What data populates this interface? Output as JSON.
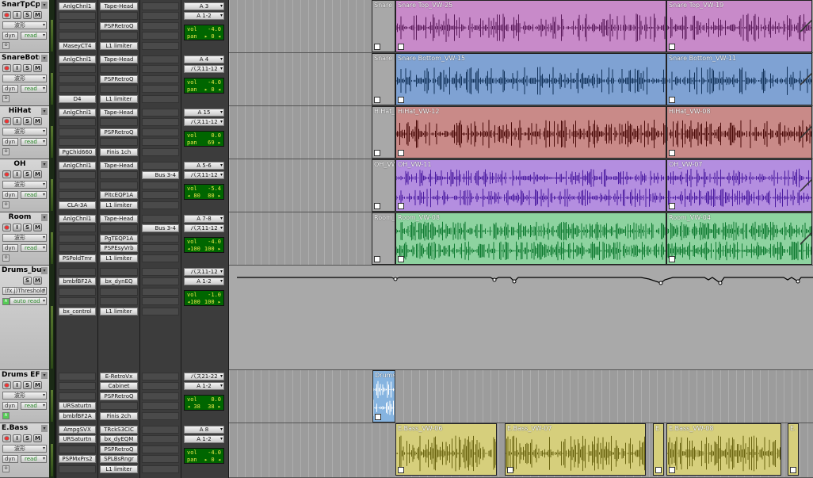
{
  "tracks": [
    {
      "name": "SnarTpCpy",
      "view": "波形",
      "auto": "read",
      "inserts_a": [
        "AnlgChnl1",
        "",
        "",
        "",
        "MaseyCT4"
      ],
      "inserts_b": [
        "Tape-Head",
        "",
        "PSPRetroQ",
        "",
        "L1 limiter"
      ],
      "send": "",
      "out_a": "A 3",
      "out_b": "A 1-2",
      "vol": "-4.0",
      "pan": "▸ 0 ◂"
    },
    {
      "name": "SnareBotm",
      "view": "波形",
      "auto": "read",
      "inserts_a": [
        "AnlgChnl1",
        "",
        "",
        "",
        "D4"
      ],
      "inserts_b": [
        "Tape-Head",
        "",
        "PSPRetroQ",
        "",
        "L1 limiter"
      ],
      "send": "",
      "out_a": "A 4",
      "out_b": "バス11-12",
      "vol": "-4.0",
      "pan": "▸ 0 ◂"
    },
    {
      "name": "HiHat",
      "view": "波形",
      "auto": "read",
      "inserts_a": [
        "AnlgChnl1",
        "",
        "",
        "",
        "PgChld660"
      ],
      "inserts_b": [
        "Tape-Head",
        "",
        "PSPRetroQ",
        "",
        "Finis 1ch"
      ],
      "send": "",
      "out_a": "A 15",
      "out_b": "バス11-12",
      "vol": "0.0",
      "pan": "69 ▸"
    },
    {
      "name": "OH",
      "view": "波形",
      "auto": "read",
      "inserts_a": [
        "AnlgChnl1",
        "",
        "",
        "",
        "CLA-3A"
      ],
      "inserts_b": [
        "Tape-Head",
        "",
        "",
        "PltcEQP1A",
        "L1 limiter"
      ],
      "send": "Bus 3-4",
      "out_a": "A 5-6",
      "out_b": "バス11-12",
      "vol": "-5.4",
      "panl": "◂ 80",
      "panr": "80 ▸"
    },
    {
      "name": "Room",
      "view": "波形",
      "auto": "read",
      "inserts_a": [
        "AnlgChnl1",
        "",
        "",
        "",
        "PSPoldTmr"
      ],
      "inserts_b": [
        "Tape-Head",
        "",
        "PgTEQP1A",
        "PSPEsyVrb",
        "L1 limiter"
      ],
      "send": "Bus 3-4",
      "out_a": "A 7-8",
      "out_b": "バス11-12",
      "vol": "-4.0",
      "panl": "◂100",
      "panr": "100 ▸"
    },
    {
      "name": "Drums_bus",
      "view": "(fx.j)Threshold",
      "auto": "auto read",
      "inserts_a": [
        "bmbfBF2A",
        "",
        "",
        "bx_control",
        ""
      ],
      "inserts_b": [
        "bx_dynEQ",
        "",
        "",
        "L1 limiter",
        ""
      ],
      "send": "",
      "out_a": "バス11-12",
      "out_b": "A 1-2",
      "vol": "-1.0",
      "panl": "◂100",
      "panr": "100 ▸"
    },
    {
      "name": "Drums EFX",
      "view": "波形",
      "auto": "read",
      "inserts_a": [
        "",
        "",
        "",
        "URSaturtn",
        "bmbfBF2A"
      ],
      "inserts_b": [
        "E-RetroVx",
        "Cabinet",
        "PSPRetroQ",
        "",
        "Finis 2ch"
      ],
      "send": "",
      "out_a": "バス21-22",
      "out_b": "A 1-2",
      "vol": "0.0",
      "panl": "◂ 38",
      "panr": "38 ▸"
    },
    {
      "name": "E.Bass",
      "view": "波形",
      "auto": "read",
      "inserts_a": [
        "AmpgSVX",
        "URSaturtn",
        "",
        "PSPMxPrs2",
        ""
      ],
      "inserts_b": [
        "TRckS3CIC",
        "bx_dyEQM",
        "PSPRetroQ",
        "SPLBsRngr",
        "L1 limiter"
      ],
      "send": "",
      "out_a": "A 8",
      "out_b": "A 1-2",
      "vol": "-4.0",
      "pan": "▸ 0 ◂"
    }
  ],
  "labels": {
    "vol": "vol",
    "pan": "pan",
    "rec": "",
    "input": "I",
    "solo": "S",
    "mute": "M",
    "dyn": "dyn"
  },
  "regions": {
    "snare_top": [
      "Snare 1",
      "Snare Top_VW-25",
      "Snare Top_VW-19"
    ],
    "snare_bottom": [
      "Snare E",
      "Snare Bottom_VW-15",
      "Snare Bottom_VW-11"
    ],
    "hihat": [
      "HiHat_",
      "HiHat_VW-12",
      "HiHat_VW-08"
    ],
    "oh": [
      "OH_VW",
      "OH_VW-11",
      "OH_VW-07"
    ],
    "room": [
      "Room_",
      "Room_VW-08",
      "Room_VW-04"
    ],
    "drums_efx": [
      "Drums"
    ],
    "ebass": [
      "E.Bass_VW-06",
      "E.Bass_VW-07",
      "E.",
      "E.Bass_VW-08",
      "E."
    ]
  },
  "colors": {
    "snare_top": "#c88ac9",
    "snare_bottom": "#7fa2d3",
    "hihat": "#c98a88",
    "oh": "#b48ee0",
    "room": "#8ed3a0",
    "ebass": "#d6cf7c",
    "drums_efx": "#86b4e0"
  }
}
